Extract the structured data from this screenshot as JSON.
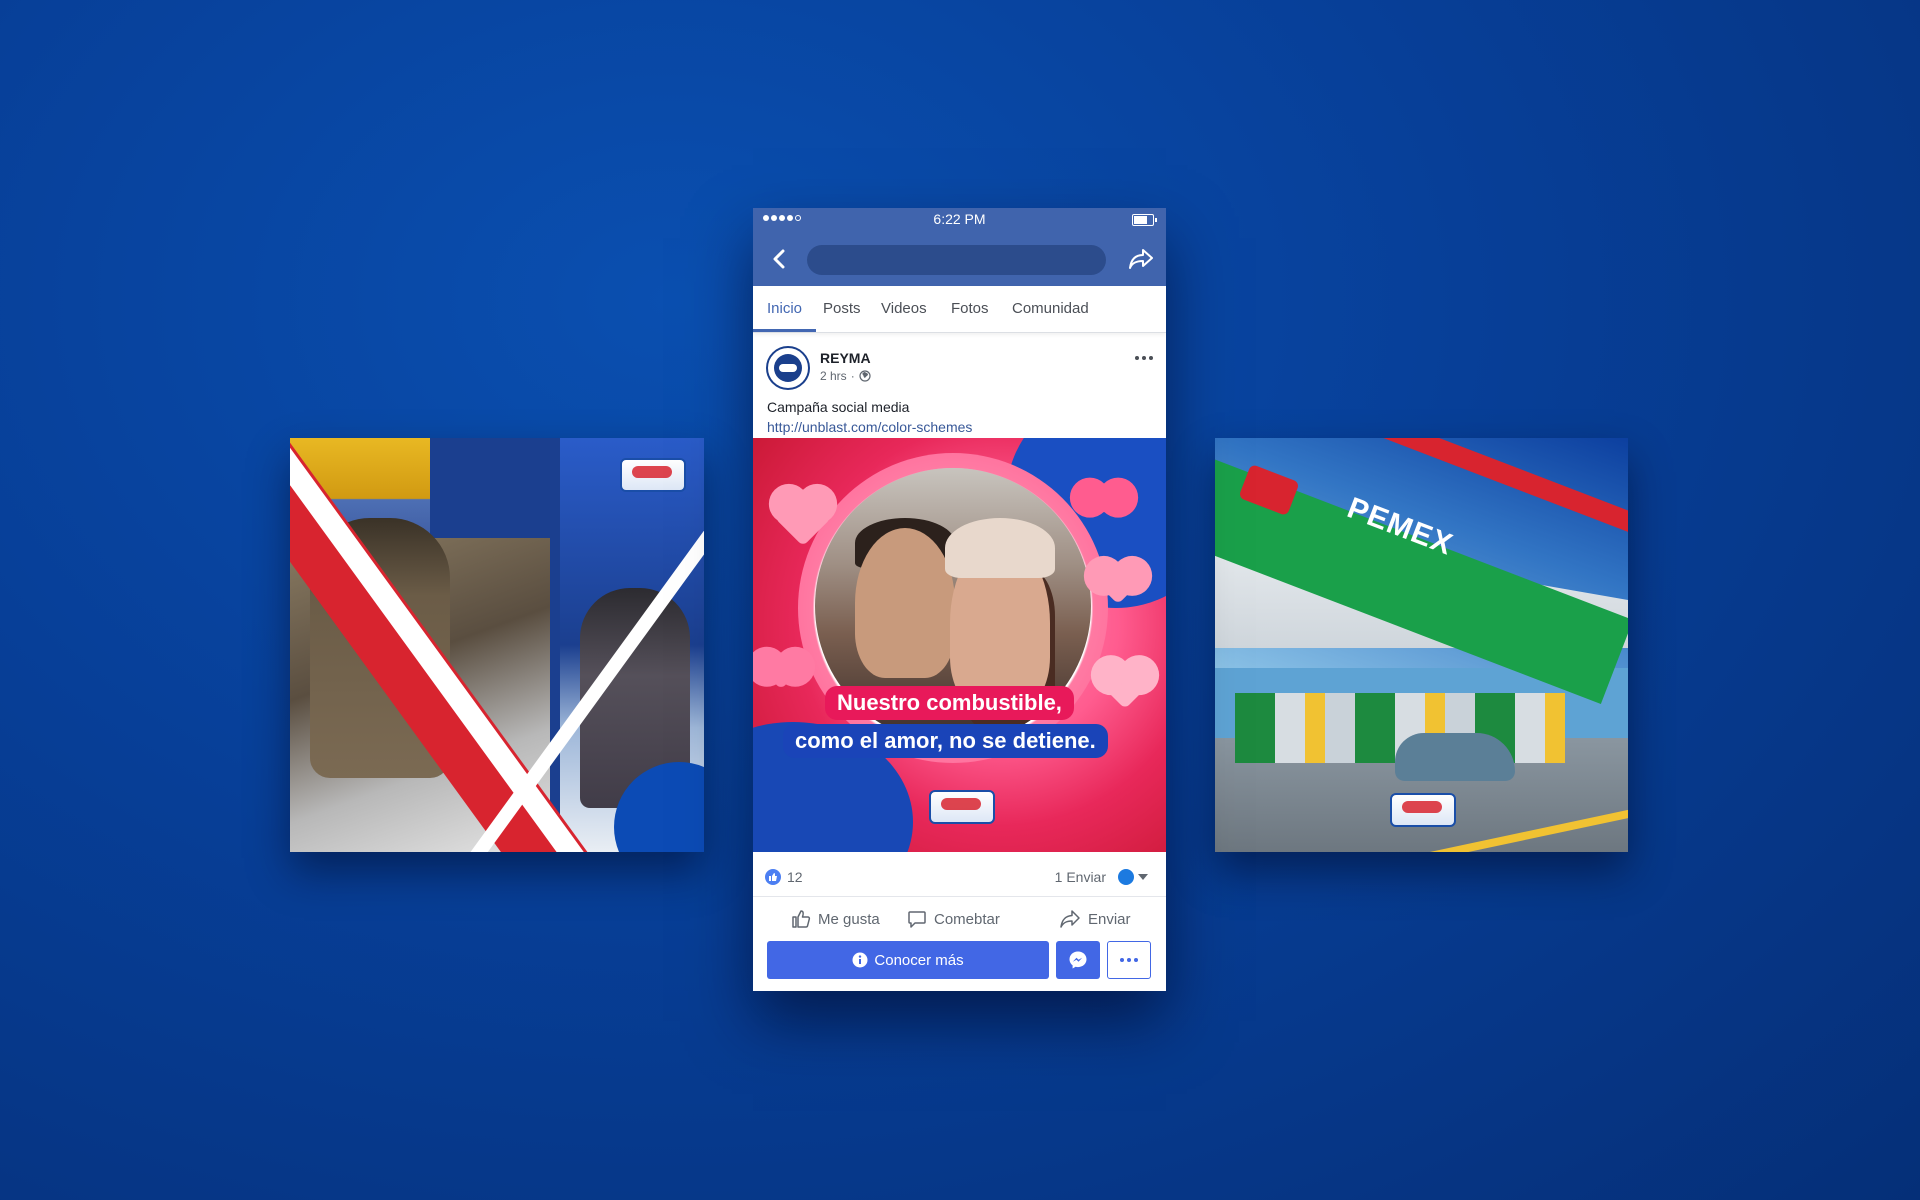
{
  "status_bar": {
    "time": "6:22 PM"
  },
  "tabs": [
    {
      "label": "Inicio",
      "active": true
    },
    {
      "label": "Posts",
      "active": false
    },
    {
      "label": "Videos",
      "active": false
    },
    {
      "label": "Fotos",
      "active": false
    },
    {
      "label": "Comunidad",
      "active": false
    }
  ],
  "post": {
    "page_name": "REYMA",
    "time": "2 hrs",
    "visibility_icon": "globe-icon",
    "text": "Campaña social media",
    "link": "http://unblast.com/color-schemes",
    "image_headline": [
      "Nuestro combustible,",
      "como el amor, no se detiene."
    ],
    "like_count": "12",
    "share_count": "1 Enviar"
  },
  "actions": {
    "like": "Me gusta",
    "comment": "Comebtar",
    "share": "Enviar"
  },
  "cta": {
    "label": "Conocer más"
  },
  "colors": {
    "background": "#073f98",
    "facebook_blue": "#4064ad",
    "cta_blue": "#4267e5",
    "link_blue": "#385898",
    "headline_pink": "#e8195a",
    "headline_blue": "#1a44b8"
  }
}
